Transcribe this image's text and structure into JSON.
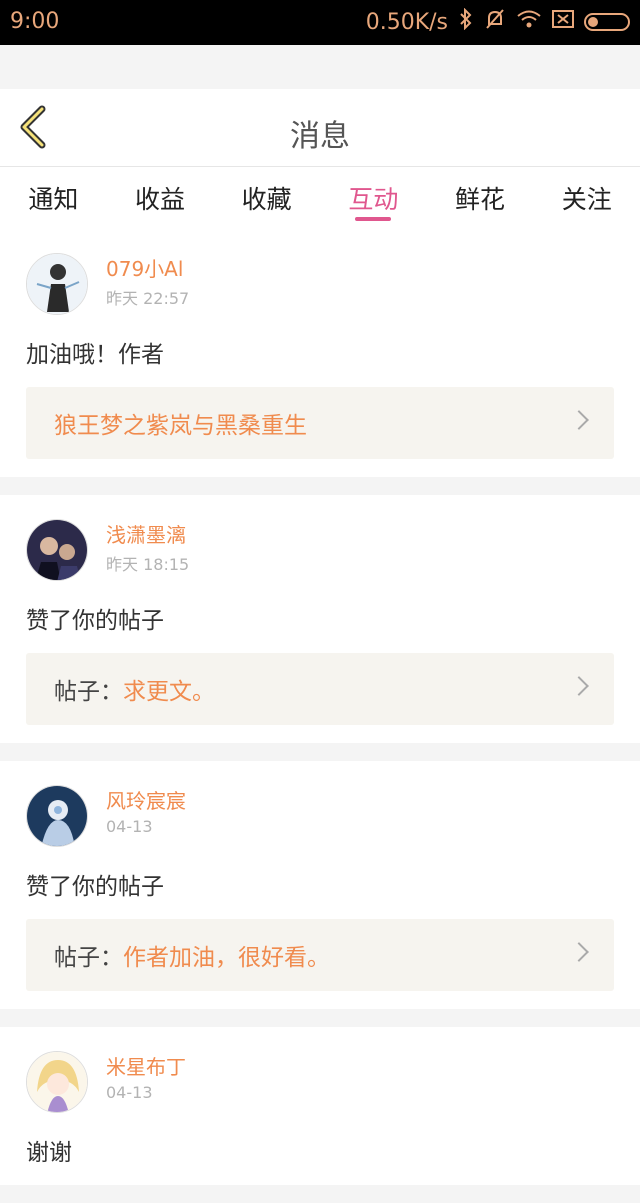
{
  "status_bar": {
    "time": "9:00",
    "net_speed": "0.50K/s",
    "icons": [
      "bluetooth-icon",
      "mute-icon",
      "wifi-icon",
      "sim-icon",
      "battery-icon"
    ]
  },
  "header": {
    "title": "消息",
    "back_icon": "chevron-left-icon"
  },
  "tabs": [
    {
      "label": "通知",
      "active": false
    },
    {
      "label": "收益",
      "active": false
    },
    {
      "label": "收藏",
      "active": false
    },
    {
      "label": "互动",
      "active": true
    },
    {
      "label": "鲜花",
      "active": false
    },
    {
      "label": "关注",
      "active": false
    }
  ],
  "colors": {
    "accent_pink": "#e0578e",
    "accent_orange": "#f08b4e",
    "ref_bg": "#f6f4ef"
  },
  "messages": [
    {
      "user": "079小Al",
      "time": "昨天 22:57",
      "content": "加油哦！作者",
      "ref_prefix": "",
      "ref_text": "狼王梦之紫岚与黑桑重生"
    },
    {
      "user": "浅潇墨漓",
      "time": "昨天 18:15",
      "content": "赞了你的帖子",
      "ref_prefix": "帖子：",
      "ref_text": "求更文。"
    },
    {
      "user": "风玲宸宸",
      "time": "04-13",
      "content": "赞了你的帖子",
      "ref_prefix": "帖子：",
      "ref_text": "作者加油，很好看。"
    },
    {
      "user": "米星布丁",
      "time": "04-13",
      "content": "谢谢",
      "ref_prefix": "",
      "ref_text": ""
    }
  ]
}
